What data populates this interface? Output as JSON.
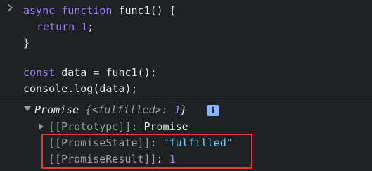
{
  "code": {
    "line1": {
      "kw1": "async",
      "kw2": "function",
      "name": "func1",
      "rest": "() {"
    },
    "line2": {
      "kw": "return",
      "num": "1",
      "rest": ";"
    },
    "line3": "}",
    "line5": {
      "kw": "const",
      "var": "data",
      "rest": " = func1();"
    },
    "line6": {
      "obj": "console",
      "dot": ".",
      "method": "log",
      "rest": "(data);"
    }
  },
  "output": {
    "promise_label": "Promise",
    "state_open": "{<",
    "state_word": "fulfilled",
    "state_close": ">: ",
    "state_value": "1",
    "state_end": "}",
    "info_icon": "info-icon",
    "prototype_key": "[[Prototype]]",
    "prototype_sep": ": ",
    "prototype_value": "Promise",
    "promise_state_key": "[[PromiseState]]",
    "promise_state_sep": ": ",
    "promise_state_value": "\"fulfilled\"",
    "promise_result_key": "[[PromiseResult]]",
    "promise_result_sep": ": ",
    "promise_result_value": "1"
  },
  "colors": {
    "background": "#202124",
    "keyword": "#9980ff",
    "string": "#5cd5fb",
    "highlight": "#e33b2e"
  }
}
